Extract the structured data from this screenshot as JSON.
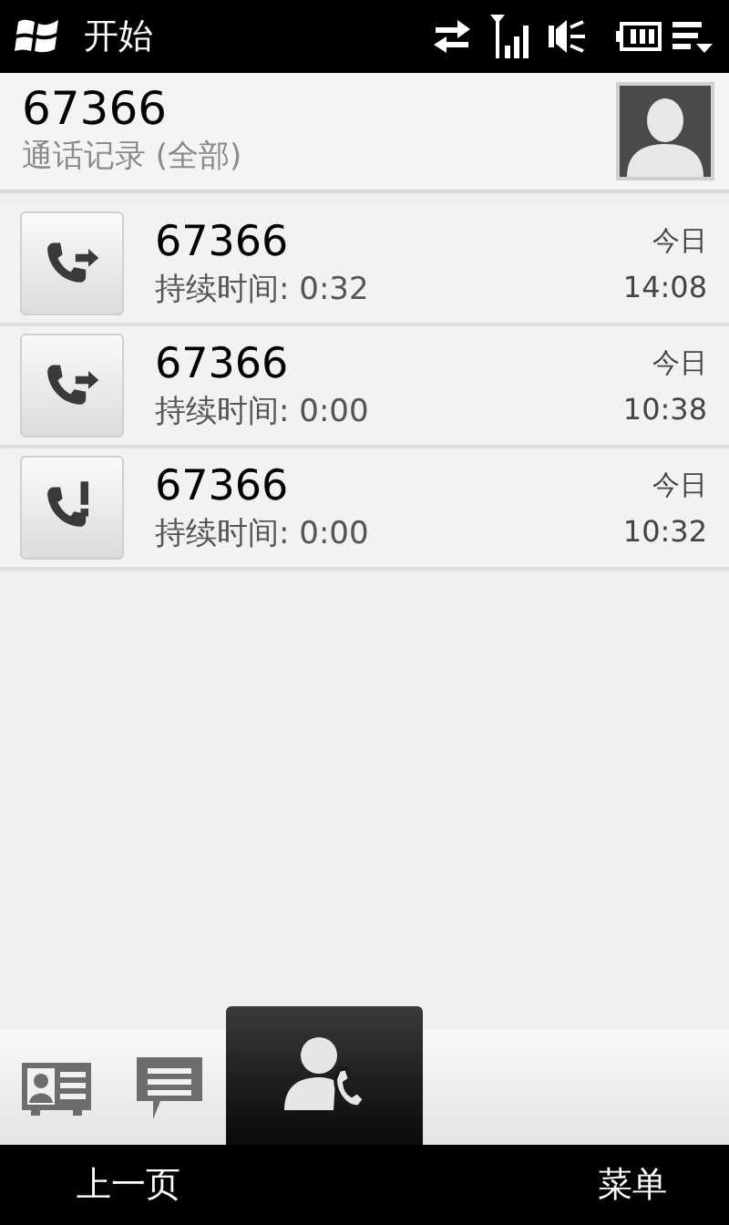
{
  "status_bar": {
    "start_label": "开始"
  },
  "header": {
    "title": "67366",
    "subtitle": "通话记录 (全部)"
  },
  "calls": [
    {
      "kind": "outgoing",
      "number": "67366",
      "duration": "持续时间: 0:32",
      "date": "今日",
      "time": "14:08"
    },
    {
      "kind": "outgoing",
      "number": "67366",
      "duration": "持续时间: 0:00",
      "date": "今日",
      "time": "10:38"
    },
    {
      "kind": "missed",
      "number": "67366",
      "duration": "持续时间: 0:00",
      "date": "今日",
      "time": "10:32"
    }
  ],
  "tabs": [
    {
      "kind": "contact",
      "selected": false
    },
    {
      "kind": "message",
      "selected": false
    },
    {
      "kind": "call_history",
      "selected": true
    }
  ],
  "softkeys": {
    "left": "上一页",
    "right": "菜单"
  }
}
